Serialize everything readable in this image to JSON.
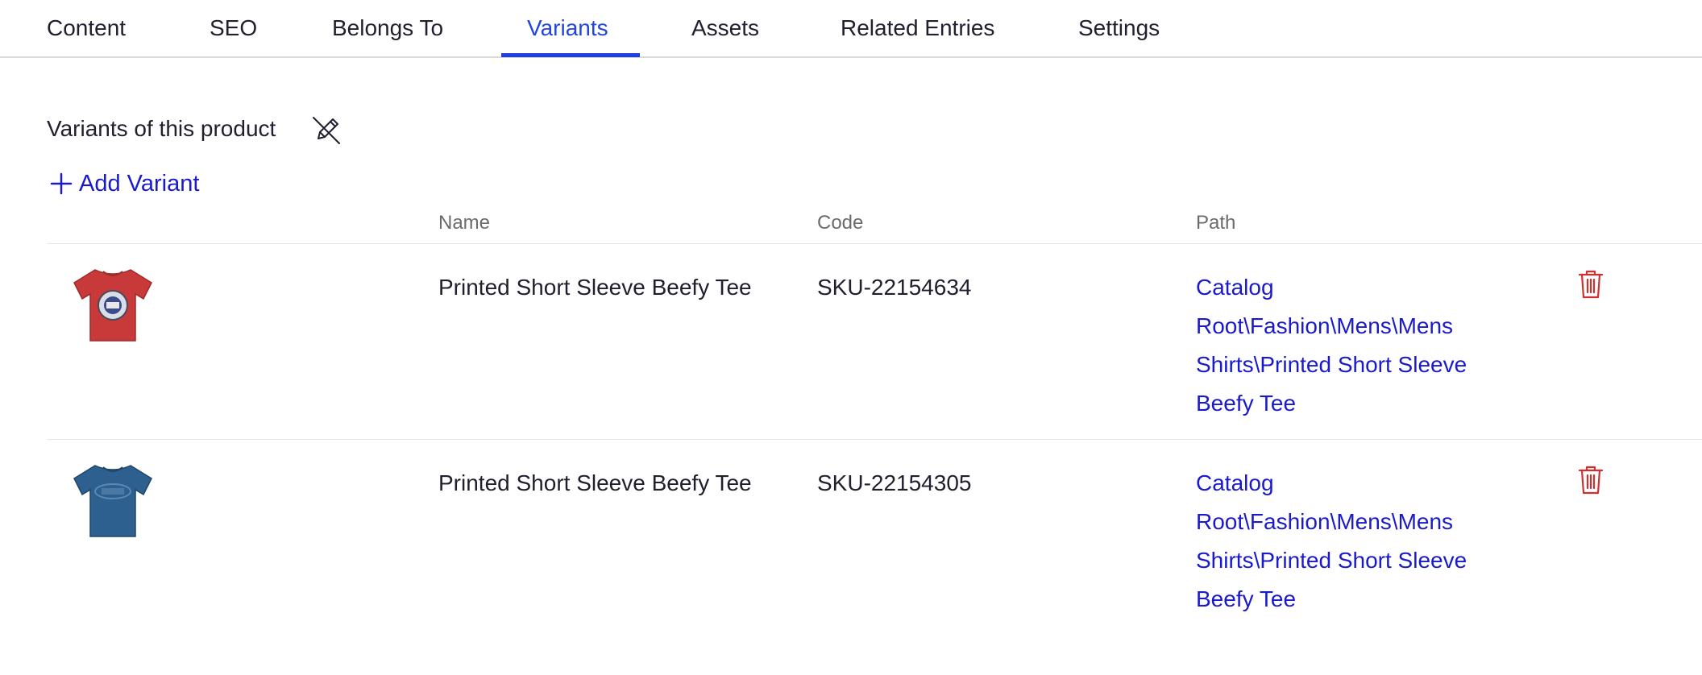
{
  "tabs": [
    {
      "label": "Content",
      "active": false
    },
    {
      "label": "SEO",
      "active": false
    },
    {
      "label": "Belongs To",
      "active": false
    },
    {
      "label": "Variants",
      "active": true
    },
    {
      "label": "Assets",
      "active": false
    },
    {
      "label": "Related Entries",
      "active": false
    },
    {
      "label": "Settings",
      "active": false
    }
  ],
  "section": {
    "title": "Variants of this product",
    "title_icon": "unlink-pencil-icon",
    "add_label": "Add Variant",
    "add_icon": "plus-icon"
  },
  "table": {
    "columns": {
      "name": "Name",
      "code": "Code",
      "path": "Path"
    },
    "rows": [
      {
        "thumbnail": "red-tshirt-image",
        "thumbnail_color": "#c8393a",
        "name": "Printed Short Sleeve Beefy Tee",
        "code": "SKU-22154634",
        "path_lines": [
          "Catalog",
          "Root\\Fashion\\Mens\\Mens",
          "Shirts\\Printed Short Sleeve",
          "Beefy Tee"
        ],
        "delete_icon": "trash-icon"
      },
      {
        "thumbnail": "blue-tshirt-image",
        "thumbnail_color": "#2d5f8f",
        "name": "Printed Short Sleeve Beefy Tee",
        "code": "SKU-22154305",
        "path_lines": [
          "Catalog",
          "Root\\Fashion\\Mens\\Mens",
          "Shirts\\Printed Short Sleeve",
          "Beefy Tee"
        ],
        "delete_icon": "trash-icon"
      }
    ]
  },
  "colors": {
    "accent": "#1f3fe0",
    "link": "#1a1acc",
    "danger": "#d03030"
  }
}
